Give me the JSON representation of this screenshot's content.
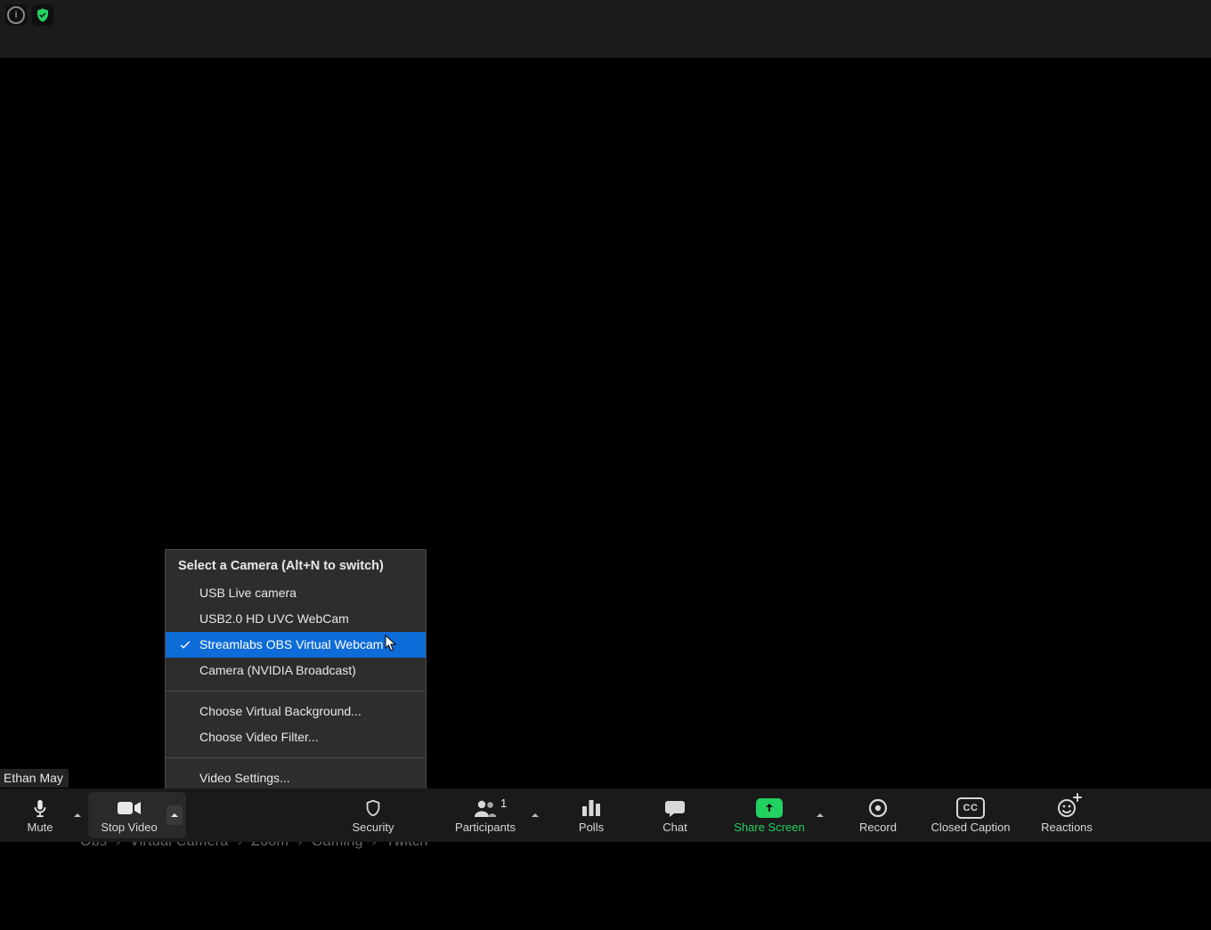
{
  "participant_name": "Ethan May",
  "camera_menu": {
    "header": "Select a Camera (Alt+N to switch)",
    "cameras": [
      {
        "label": "USB  Live camera",
        "selected": false
      },
      {
        "label": "USB2.0 HD UVC WebCam",
        "selected": false
      },
      {
        "label": "Streamlabs OBS Virtual Webcam",
        "selected": true,
        "highlighted": true
      },
      {
        "label": "Camera (NVIDIA Broadcast)",
        "selected": false
      }
    ],
    "choose_bg": "Choose Virtual Background...",
    "choose_filter": "Choose Video Filter...",
    "video_settings": "Video Settings..."
  },
  "toolbar": {
    "mute": "Mute",
    "stop_video": "Stop Video",
    "security": "Security",
    "participants": "Participants",
    "participants_count": "1",
    "polls": "Polls",
    "chat": "Chat",
    "share_screen": "Share Screen",
    "record": "Record",
    "closed_caption": "Closed Caption",
    "reactions": "Reactions"
  },
  "footer_crumbs": [
    "Obs",
    "Virtual Camera",
    "Zoom",
    "Gaming",
    "Twitch"
  ]
}
